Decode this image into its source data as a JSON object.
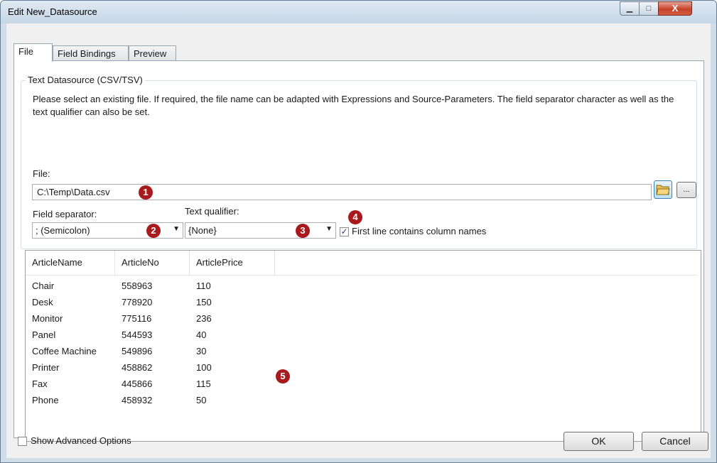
{
  "window": {
    "title": "Edit New_Datasource",
    "minimize_glyph": "▁",
    "maximize_glyph": "□",
    "close_glyph": "X"
  },
  "tabs": [
    {
      "label": "File",
      "active": true
    },
    {
      "label": "Field Bindings",
      "active": false
    },
    {
      "label": "Preview",
      "active": false
    }
  ],
  "group": {
    "title": "Text Datasource (CSV/TSV)",
    "description": "Please select an existing file. If required, the file name can be adapted with Expressions and Source-Parameters. The field separator character as well as the text qualifier can also be set."
  },
  "file": {
    "label": "File:",
    "value": "C:\\Temp\\Data.csv",
    "browse_icon": "folder-open-icon",
    "more_label": "..."
  },
  "field_separator": {
    "label": "Field separator:",
    "value": "; (Semicolon)"
  },
  "text_qualifier": {
    "label": "Text qualifier:",
    "value": "{None}"
  },
  "first_line_checkbox": {
    "label": "First line contains column names",
    "checked": true
  },
  "badges": [
    "1",
    "2",
    "3",
    "4",
    "5"
  ],
  "table": {
    "columns": [
      "ArticleName",
      "ArticleNo",
      "ArticlePrice"
    ],
    "rows": [
      [
        "Chair",
        "558963",
        "110"
      ],
      [
        "Desk",
        "778920",
        "150"
      ],
      [
        "Monitor",
        "775116",
        "236"
      ],
      [
        "Panel",
        "544593",
        "40"
      ],
      [
        "Coffee Machine",
        "549896",
        "30"
      ],
      [
        "Printer",
        "458862",
        "100"
      ],
      [
        "Fax",
        "445866",
        "115"
      ],
      [
        "Phone",
        "458932",
        "50"
      ]
    ]
  },
  "advanced_checkbox": {
    "label": "Show Advanced Options",
    "checked": false
  },
  "buttons": {
    "ok": "OK",
    "cancel": "Cancel"
  },
  "colors": {
    "badge": "#a81a1e",
    "close_button": "#c7412a",
    "window_frame": "#cfdde9"
  }
}
